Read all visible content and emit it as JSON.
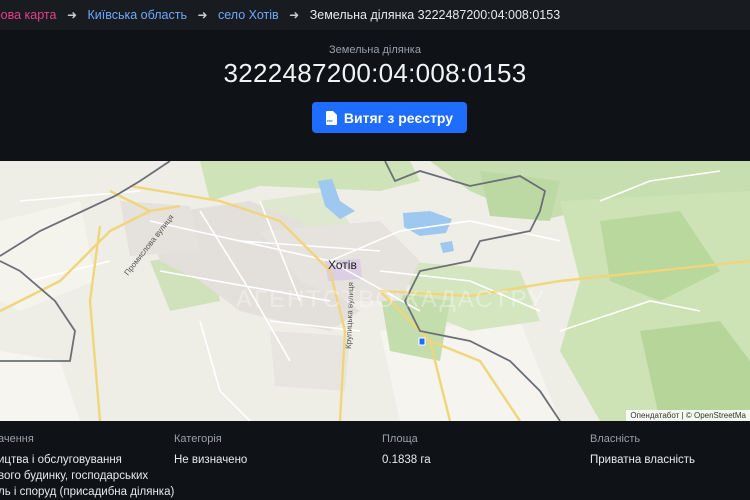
{
  "breadcrumb": {
    "items": [
      "трова карта",
      "Київська область",
      "село Хотів",
      "Земельна ділянка 3222487200:04:008:0153"
    ],
    "arrow_icon": "arrow-right-icon"
  },
  "header": {
    "subtitle": "Земельна ділянка",
    "cadastral_number": "3222487200:04:008:0153",
    "button_label": "Витяг з реєстру",
    "button_icon": "pdf-file-icon",
    "button_icon_text": "PDF",
    "accent_color": "#1f6dff"
  },
  "map": {
    "place_label": "Хотів",
    "street_1": "Промислова вулиця",
    "street_2": "Крупицька вулиця",
    "watermark": "АГЕНТСТВО КАДАСТРУ",
    "attribution": "Опендатабот | © OpenStreetMa"
  },
  "details": {
    "purpose": {
      "label": "ачення",
      "lines": [
        "ицтва і обслуговування",
        "вого будинку, господарських",
        "ль і споруд (присадибна ділянка)"
      ]
    },
    "category": {
      "label": "Категорія",
      "value": "Не визначено"
    },
    "area": {
      "label": "Площа",
      "value": "0.1838 га"
    },
    "ownership": {
      "label": "Власність",
      "value": "Приватна власність"
    }
  }
}
